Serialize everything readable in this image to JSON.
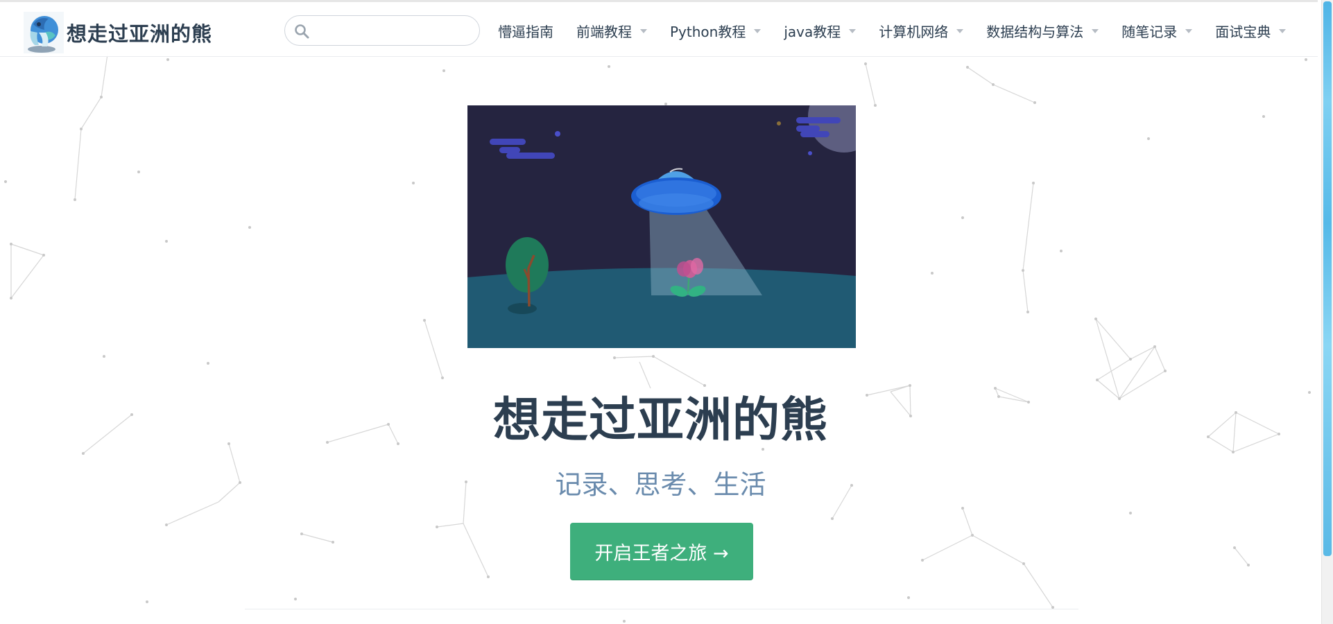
{
  "navbar": {
    "site_name": "想走过亚洲的熊",
    "logo_icon": "bear-logo-icon",
    "search": {
      "value": "",
      "placeholder": "",
      "icon": "search-icon"
    },
    "nav_items": [
      {
        "label": "懵逼指南",
        "has_dropdown": false
      },
      {
        "label": "前端教程",
        "has_dropdown": true
      },
      {
        "label": "Python教程",
        "has_dropdown": true
      },
      {
        "label": "java教程",
        "has_dropdown": true
      },
      {
        "label": "计算机网络",
        "has_dropdown": true
      },
      {
        "label": "数据结构与算法",
        "has_dropdown": true
      },
      {
        "label": "随笔记录",
        "has_dropdown": true
      },
      {
        "label": "面试宝典",
        "has_dropdown": true
      }
    ]
  },
  "hero": {
    "image": "ufo-night-illustration",
    "title": "想走过亚洲的熊",
    "description": "记录、思考、生活",
    "action_label": "开启王者之旅 →"
  },
  "colors": {
    "accent": "#3eaf7c",
    "text": "#2c3e50",
    "description": "#6a8bad",
    "illustration_sky": "#252440",
    "illustration_ground": "#205a73"
  }
}
